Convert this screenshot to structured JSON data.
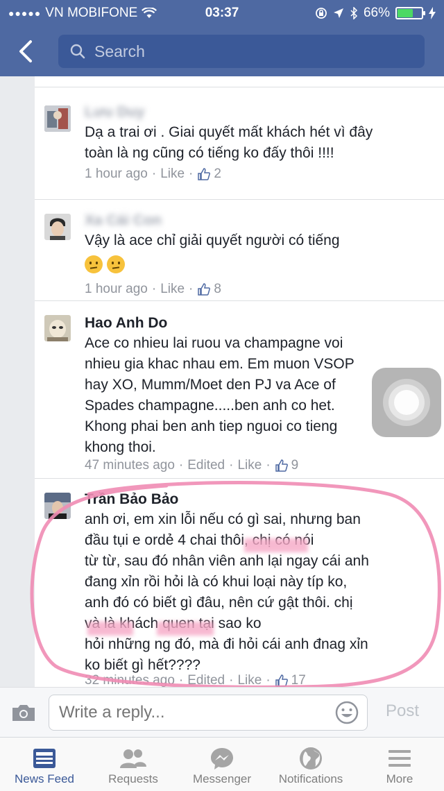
{
  "status": {
    "signal_dots": "●●●●●",
    "carrier": "VN MOBIFONE",
    "time": "03:37",
    "battery": "66%",
    "battery_level": 0.66
  },
  "search": {
    "placeholder": "Search"
  },
  "colors": {
    "brand": "#4e69a2",
    "brand_dark": "#3b5998",
    "meta": "#90949c",
    "annotation": "#f08cb4"
  },
  "comments": [
    {
      "name": "Lưu Duy",
      "text": "Dạ a trai ơi . Giai quyết mất khách hét vì đây\ntoàn là ng cũng có tiếng ko đấy thôi !!!!",
      "time": "1 hour ago",
      "like": "Like",
      "likes": "2"
    },
    {
      "name": "Xa Cái Con",
      "text": "Vậy là ace chỉ giải quyết người có tiếng",
      "time": "1 hour ago",
      "like": "Like",
      "likes": "8"
    },
    {
      "name": "Hao Anh Do",
      "text": "Ace co nhieu lai ruou va champagne voi\nnhieu gia khac nhau em.  Em muon VSOP\nhay XO, Mumm/Moet den PJ va Ace of\nSpades champagne.....ben anh co het.\nKhong phai ben anh tiep nguoi co tieng\nkhong thoi.",
      "time": "47 minutes ago",
      "edited": "Edited",
      "like": "Like",
      "likes": "9"
    },
    {
      "name": "Trần Bảo Bảo",
      "text": "anh ơi, em xin lỗi nếu có gì sai, nhưng ban\nđầu tụi e ordẻ 4 chai thôi, chị             có nói\ntừ từ, sau đó nhân viên anh lại ngay cái anh\nđang xỉn rồi hỏi là có khui loại này típ ko,\nanh đó có biết gì đâu, nên cứ gật thôi. chị\n              và                  là khách quen tại sao ko\nhỏi những ng đó, mà đi hỏi cái anh đnag xỉn\nko biết gì hết????",
      "time": "32 minutes ago",
      "edited": "Edited",
      "like": "Like",
      "likes": "17"
    }
  ],
  "reply": {
    "placeholder": "Write a reply...",
    "post_label": "Post"
  },
  "tabs": [
    {
      "label": "News Feed",
      "icon": "news-feed-icon",
      "active": true
    },
    {
      "label": "Requests",
      "icon": "friend-requests-icon",
      "active": false
    },
    {
      "label": "Messenger",
      "icon": "messenger-icon",
      "active": false
    },
    {
      "label": "Notifications",
      "icon": "globe-icon",
      "active": false
    },
    {
      "label": "More",
      "icon": "menu-icon",
      "active": false
    }
  ]
}
